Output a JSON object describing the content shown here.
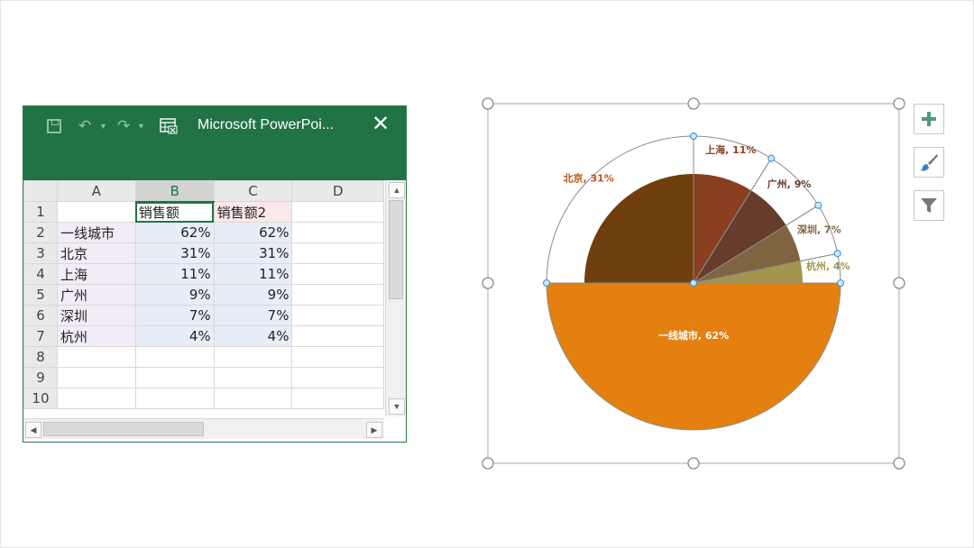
{
  "excel": {
    "window_title": "Microsoft PowerPoi...",
    "close_glyph": "✕",
    "columns": [
      "A",
      "B",
      "C",
      "D"
    ],
    "rows": [
      {
        "num": "1",
        "a": "",
        "b": "销售额",
        "c": "销售额2"
      },
      {
        "num": "2",
        "a": "一线城市",
        "b": "62%",
        "c": "62%"
      },
      {
        "num": "3",
        "a": "北京",
        "b": "31%",
        "c": "31%"
      },
      {
        "num": "4",
        "a": "上海",
        "b": "11%",
        "c": "11%"
      },
      {
        "num": "5",
        "a": "广州",
        "b": "9%",
        "c": "9%"
      },
      {
        "num": "6",
        "a": "深圳",
        "b": "7%",
        "c": "7%"
      },
      {
        "num": "7",
        "a": "杭州",
        "b": "4%",
        "c": "4%"
      },
      {
        "num": "8",
        "a": "",
        "b": "",
        "c": ""
      },
      {
        "num": "9",
        "a": "",
        "b": "",
        "c": ""
      },
      {
        "num": "10",
        "a": "",
        "b": "",
        "c": ""
      }
    ],
    "icons": [
      "save-icon",
      "undo-icon",
      "redo-icon",
      "table-icon",
      "close-icon"
    ]
  },
  "chart_data": {
    "type": "pie",
    "categories": [
      "一线城市",
      "北京",
      "上海",
      "广州",
      "深圳",
      "杭州"
    ],
    "values": [
      62,
      31,
      11,
      9,
      7,
      4
    ],
    "labels": [
      "一线城市, 62%",
      "北京, 31%",
      "上海, 11%",
      "广州, 9%",
      "深圳, 7%",
      "杭州, 4%"
    ],
    "colors": [
      "#e48010",
      "#6e3f0c",
      "#8a3f20",
      "#683c2a",
      "#7e6440",
      "#a3964c"
    ],
    "label_colors": [
      "#ffffff",
      "#b8560e",
      "#8a3f20",
      "#683c2a",
      "#7e6440",
      "#a3964c"
    ],
    "outer_series_values": [
      62,
      31,
      11,
      9,
      7,
      4
    ],
    "outer_series_style": "outline"
  },
  "chart_buttons": [
    "plus-icon",
    "brush-icon",
    "filter-icon"
  ]
}
